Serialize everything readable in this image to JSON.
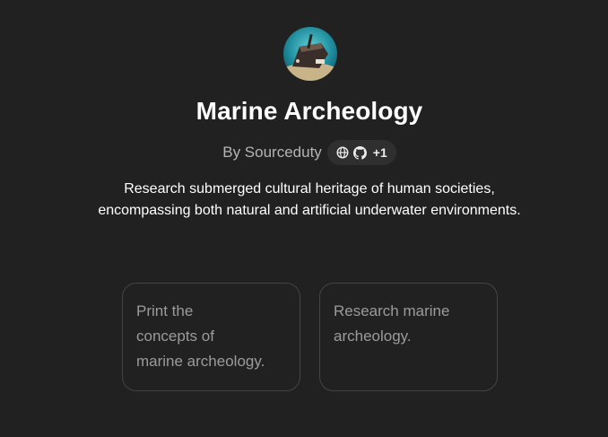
{
  "gpt": {
    "name": "Marine Archeology",
    "author": "By Sourceduty",
    "extra_links_count": "+1",
    "description_line1": "Research submerged cultural heritage of human societies,",
    "description_line2": "encompassing both natural and artificial underwater environments."
  },
  "icons": {
    "avatar": "shipwreck-avatar",
    "link": "globe-icon",
    "repo": "github-icon"
  },
  "starters": [
    {
      "line1": "Print the",
      "line2": "concepts of",
      "line3": "marine archeology."
    },
    {
      "line1": "Research marine",
      "line2": "archeology.",
      "line3": ""
    }
  ],
  "colors": {
    "background": "#212121",
    "title": "#ffffff",
    "author": "#b4b4b4",
    "pill_background": "#2f2f2f",
    "card_border": "#444444",
    "card_text": "#9b9b9b"
  }
}
